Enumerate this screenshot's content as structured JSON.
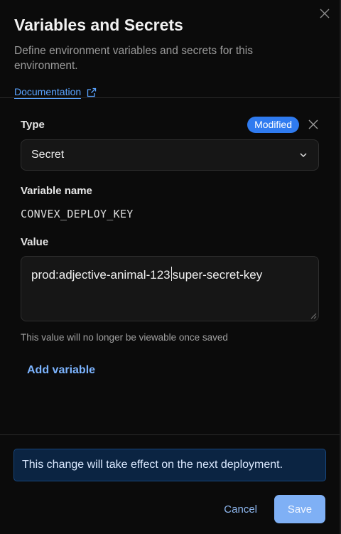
{
  "header": {
    "title": "Variables and Secrets",
    "subtitle": "Define environment variables and secrets for this environment.",
    "doc_link": "Documentation"
  },
  "form": {
    "type_label": "Type",
    "modified_badge": "Modified",
    "type_value": "Secret",
    "name_label": "Variable name",
    "name_value": "CONVEX_DEPLOY_KEY",
    "value_label": "Value",
    "value_before_caret": "prod:adjective-animal-123",
    "value_after_caret": "super-secret-key",
    "hint": "This value will no longer be viewable once saved",
    "add_variable": "Add variable"
  },
  "footer": {
    "notice": "This change will take effect on the next deployment.",
    "cancel_label": "Cancel",
    "save_label": "Save"
  },
  "colors": {
    "accent": "#2f7bf0",
    "link": "#5aa3ff",
    "notice_bg": "#0b2442",
    "save_bg": "#7fb0f5"
  },
  "icons": {
    "close": "close-icon",
    "external": "external-link-icon",
    "chevron": "chevron-down-icon",
    "remove": "remove-icon"
  }
}
